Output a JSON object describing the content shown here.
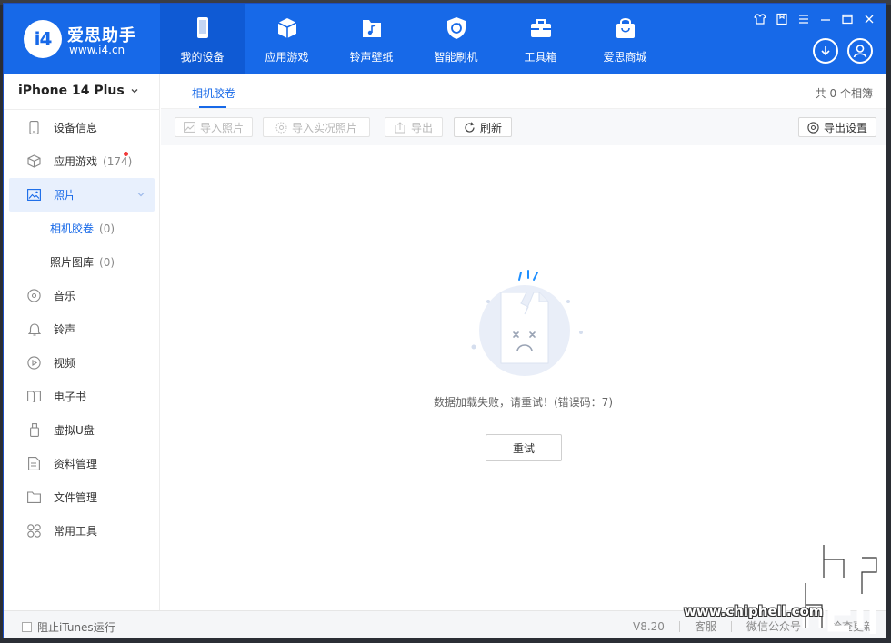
{
  "app": {
    "name": "爱思助手",
    "url": "www.i4.cn",
    "logo_mark": "i4",
    "accent_color": "#1769e8"
  },
  "nav": [
    {
      "label": "我的设备",
      "icon": "phone-icon"
    },
    {
      "label": "应用游戏",
      "icon": "cube-icon"
    },
    {
      "label": "铃声壁纸",
      "icon": "music-folder-icon"
    },
    {
      "label": "智能刷机",
      "icon": "refresh-shield-icon"
    },
    {
      "label": "工具箱",
      "icon": "toolbox-icon"
    },
    {
      "label": "爱思商城",
      "icon": "shopping-bag-icon"
    }
  ],
  "device": {
    "name": "iPhone 14 Plus"
  },
  "sidebar": {
    "items": [
      {
        "label": "设备信息",
        "icon": "device-icon"
      },
      {
        "label": "应用游戏",
        "count": "(174)",
        "icon": "apps-icon"
      },
      {
        "label": "照片",
        "icon": "photo-icon"
      },
      {
        "label": "相机胶卷",
        "count": "(0)"
      },
      {
        "label": "照片图库",
        "count": "(0)"
      },
      {
        "label": "音乐",
        "icon": "music-icon"
      },
      {
        "label": "铃声",
        "icon": "bell-icon"
      },
      {
        "label": "视频",
        "icon": "video-icon"
      },
      {
        "label": "电子书",
        "icon": "book-icon"
      },
      {
        "label": "虚拟U盘",
        "icon": "usb-icon"
      },
      {
        "label": "资料管理",
        "icon": "document-icon"
      },
      {
        "label": "文件管理",
        "icon": "folder-icon"
      },
      {
        "label": "常用工具",
        "icon": "tools-icon"
      }
    ]
  },
  "content": {
    "tab": "相机胶卷",
    "total": "共 0 个相簿",
    "toolbar": {
      "import_photos": "导入照片",
      "import_live": "导入实况照片",
      "export": "导出",
      "refresh": "刷新",
      "export_settings": "导出设置"
    },
    "error_message": "数据加载失败，请重试！(错误码：7)",
    "retry_label": "重试"
  },
  "statusbar": {
    "itunes_label": "阻止iTunes运行",
    "version": "V8.20",
    "support": "客服",
    "wechat": "微信公众号",
    "check_update": "检查更新"
  },
  "watermark": {
    "url": "www.chiphell.com"
  }
}
